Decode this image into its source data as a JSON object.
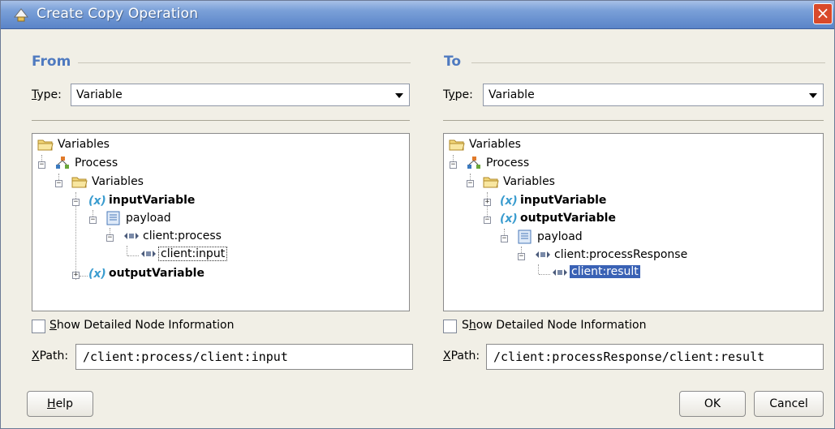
{
  "window": {
    "title": "Create Copy Operation",
    "close_label": "×"
  },
  "from": {
    "group_title": "From",
    "type_label": "Type:",
    "type_value": "Variable",
    "tree": {
      "n0": "Variables",
      "n1": "Process",
      "n2": "Variables",
      "n3": "inputVariable",
      "n4": "payload",
      "n5": "client:process",
      "n6": "client:input",
      "n7": "outputVariable"
    },
    "show_detail_label": "Show Detailed Node Information",
    "xpath_label": "XPath:",
    "xpath_value": "/client:process/client:input"
  },
  "to": {
    "group_title": "To",
    "type_label": "Type:",
    "type_value": "Variable",
    "tree": {
      "n0": "Variables",
      "n1": "Process",
      "n2": "Variables",
      "n3": "inputVariable",
      "n4": "outputVariable",
      "n5": "payload",
      "n6": "client:processResponse",
      "n7": "client:result"
    },
    "show_detail_label": "Show Detailed Node Information",
    "xpath_label": "XPath:",
    "xpath_value": "/client:processResponse/client:result"
  },
  "buttons": {
    "help": "Help",
    "ok": "OK",
    "cancel": "Cancel"
  },
  "colors": {
    "titlebar": "#5a84c8",
    "group_title": "#4f7ac0",
    "selection": "#3a62b5",
    "variable_icon": "#3a9ccf"
  }
}
